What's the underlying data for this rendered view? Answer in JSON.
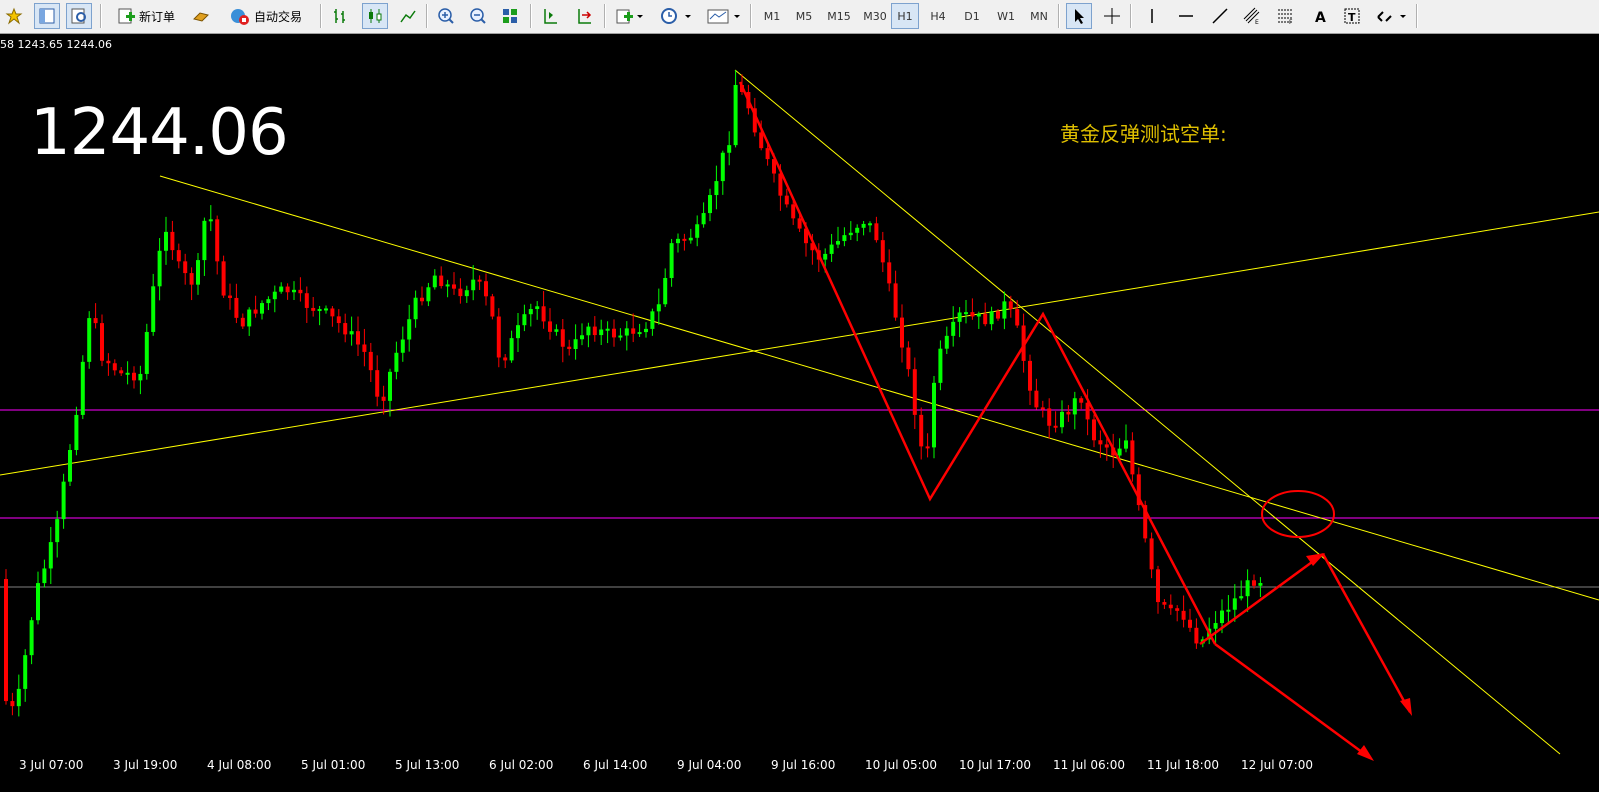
{
  "toolbar": {
    "new_order": "新订单",
    "auto_trading": "自动交易",
    "timeframes": [
      "M1",
      "M5",
      "M15",
      "M30",
      "H1",
      "H4",
      "D1",
      "W1",
      "MN"
    ],
    "active_timeframe": "H1"
  },
  "chart": {
    "quote_line": "58 1243.65 1244.06",
    "big_price": "1244.06",
    "annotation": "黄金反弹测试空单:",
    "x_labels": [
      "3 Jul 07:00",
      "3 Jul 19:00",
      "4 Jul 08:00",
      "5 Jul 01:00",
      "5 Jul 13:00",
      "6 Jul 02:00",
      "6 Jul 14:00",
      "9 Jul 04:00",
      "9 Jul 16:00",
      "10 Jul 05:00",
      "10 Jul 17:00",
      "11 Jul 06:00",
      "11 Jul 18:00",
      "12 Jul 07:00"
    ],
    "colors": {
      "bull": "#00ff00",
      "bear": "#ff0000",
      "trendline": "#ffff00",
      "level": "#ff00ff",
      "price_line": "#808080",
      "arrow": "#ff0000"
    }
  }
}
